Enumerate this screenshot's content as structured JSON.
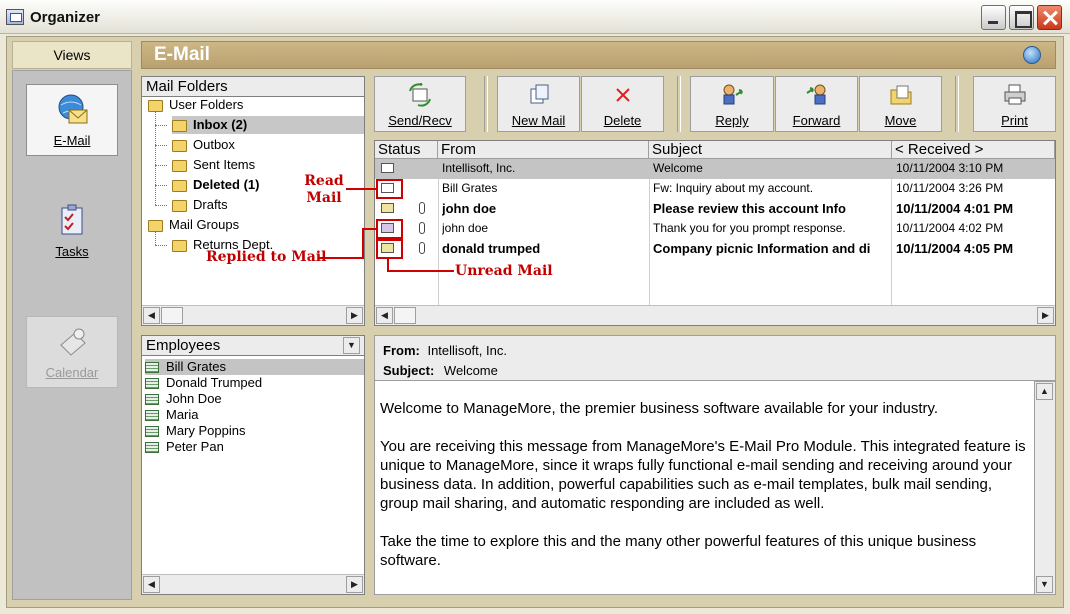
{
  "window": {
    "title": "Organizer"
  },
  "views": {
    "header": "Views",
    "items": [
      {
        "label": "E-Mail",
        "state": "active"
      },
      {
        "label": "Tasks",
        "state": "normal"
      },
      {
        "label": "Calendar",
        "state": "disabled"
      }
    ]
  },
  "section": {
    "title": "E-Mail"
  },
  "folders": {
    "title": "Mail Folders",
    "items": [
      {
        "label": "User Folders"
      },
      {
        "label": "Inbox (2)"
      },
      {
        "label": "Outbox"
      },
      {
        "label": "Sent Items"
      },
      {
        "label": "Deleted (1)"
      },
      {
        "label": "Drafts"
      },
      {
        "label": "Mail Groups"
      },
      {
        "label": "Returns Dept."
      }
    ]
  },
  "toolbar": {
    "send_recv": "Send/Recv",
    "new_mail": "New Mail",
    "delete": "Delete",
    "reply": "Reply",
    "forward": "Forward",
    "move": "Move",
    "print": "Print"
  },
  "mail": {
    "columns": {
      "status": "Status",
      "from": "From",
      "subject": "Subject",
      "received": "< Received >"
    },
    "rows": [
      {
        "status": "read",
        "attachment": false,
        "from": "Intellisoft, Inc.",
        "subject": "Welcome",
        "received": "10/11/2004  3:10 PM"
      },
      {
        "status": "read",
        "attachment": false,
        "from": "Bill Grates",
        "subject": "Fw: Inquiry about my account.",
        "received": "10/11/2004  3:26 PM"
      },
      {
        "status": "unread",
        "attachment": true,
        "from": "john doe",
        "subject": "Please review this account Info",
        "received": "10/11/2004  4:01 PM"
      },
      {
        "status": "replied",
        "attachment": true,
        "from": "john doe",
        "subject": "Thank you for you prompt response.",
        "received": "10/11/2004  4:02 PM"
      },
      {
        "status": "unread",
        "attachment": true,
        "from": "donald trumped",
        "subject": "Company picnic Information and di",
        "received": "10/11/2004  4:05 PM"
      }
    ]
  },
  "annotations": {
    "read": "Read Mail",
    "replied": "Replied to Mail",
    "unread": "Unread Mail"
  },
  "employees": {
    "title": "Employees",
    "items": [
      "Bill Grates",
      "Donald Trumped",
      "John Doe",
      "Maria",
      "Mary Poppins",
      "Peter Pan"
    ]
  },
  "preview": {
    "from_label": "From:",
    "from_value": "Intellisoft, Inc.",
    "subject_label": "Subject:",
    "subject_value": "Welcome",
    "body": [
      "Welcome to ManageMore, the premier business software available for your industry.",
      "You are receiving this message from ManageMore's E-Mail Pro Module.  This integrated feature is unique to ManageMore, since it wraps fully functional e-mail sending and receiving around your business data.  In addition, powerful capabilities such as e-mail templates, bulk mail sending, group mail sharing, and automatic responding are included as well.",
      "Take the time to explore this and the many other powerful features of this unique business software."
    ]
  },
  "colors": {
    "header_bg": "#c3ab7b",
    "frame_bg": "#d7cfae",
    "annotation": "#cc0000",
    "selection": "#c4c4c4"
  }
}
